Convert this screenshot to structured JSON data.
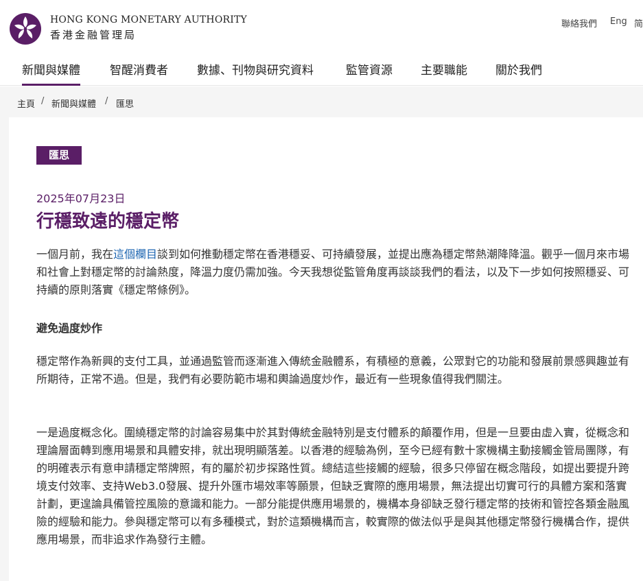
{
  "header": {
    "org_en": "HONG KONG MONETARY AUTHORITY",
    "org_zh": "香港金融管理局",
    "logo_icon": "bauhinia-logo-icon",
    "utility": {
      "contact": "聯絡我們",
      "eng": "Eng",
      "simplified": "简"
    }
  },
  "nav": {
    "items": [
      {
        "label": "新聞與媒體",
        "active": true
      },
      {
        "label": "智醒消費者"
      },
      {
        "label": "數據、刊物與研究資料"
      },
      {
        "label": "監管資源"
      },
      {
        "label": "主要職能"
      },
      {
        "label": "關於我們"
      }
    ]
  },
  "breadcrumb": {
    "items": [
      "主頁",
      "新聞與媒體",
      "匯思"
    ],
    "separator": "/"
  },
  "article": {
    "badge": "匯思",
    "date": "2025年07月23日",
    "title": "行穩致遠的穩定幣",
    "para1_before": "一個月前，我在",
    "para1_link": "這個欄目",
    "para1_after": "談到如何推動穩定幣在香港穩妥、可持續發展，並提出應為穩定幣熱潮降降溫。觀乎一個月來市場和社會上對穩定幣的討論熱度，降溫力度仍需加強。今天我想從監管角度再談談我們的看法，以及下一步如何按照穩妥、可持續的原則落實《穩定幣條例》。",
    "subheading": "避免過度炒作",
    "para2": "穩定幣作為新興的支付工具，並通過監管而逐漸進入傳統金融體系，有積極的意義，公眾對它的功能和發展前景感興趣並有所期待，正常不過。但是，我們有必要防範市場和輿論過度炒作，最近有一些現象值得我們關注。",
    "para3": "一是過度概念化。圍繞穩定幣的討論容易集中於其對傳統金融特別是支付體系的顛覆作用，但是一旦要由虛入實，從概念和理論層面轉到應用場景和具體安排，就出現明顯落差。以香港的經驗為例，至今已經有數十家機構主動接觸金管局團隊，有的明確表示有意申請穩定幣牌照，有的屬於初步探路性質。總結這些接觸的經驗，很多只停留在概念階段，如提出要提升跨境支付效率、支持Web3.0發展、提升外匯市場效率等願景，但缺乏實際的應用場景，無法提出切實可行的具體方案和落實計劃，更遑論具備管控風險的意識和能力。一部分能提供應用場景的，機構本身卻缺乏發行穩定幣的技術和管控各類金融風險的經驗和能力。參與穩定幣可以有多種模式，對於這類機構而言，較實際的做法似乎是與其他穩定幣發行機構合作，提供應用場景，而非追求作為發行主體。"
  },
  "colors": {
    "brand_purple": "#5a1e66",
    "link_blue": "#1a63b0",
    "breadcrumb_bg": "#f5f5f5"
  }
}
